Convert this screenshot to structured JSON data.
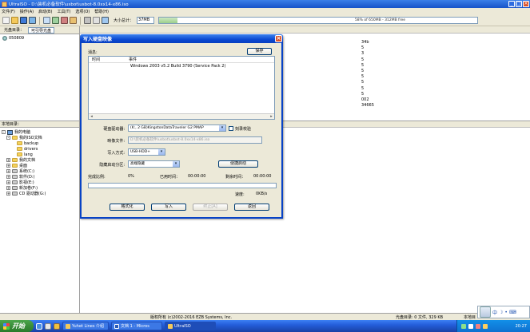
{
  "window": {
    "title": "UltraISO - D:\\装机必备软件\\usbot\\usbot-8.0xx14-x86.iso"
  },
  "menu": [
    "文件(F)",
    "操作(A)",
    "启动(B)",
    "工具(T)",
    "选项(O)",
    "帮助(H)"
  ],
  "toolbar": {
    "capacity_label": "大小总计：",
    "capacity_value": "37MB",
    "capacity_info": "58% of 650MB - 312MB free",
    "capacity_fraction": 0.058
  },
  "left_top": {
    "tabs": [
      "光盘目录：",
      "可引导光盘"
    ],
    "root_label": "050809"
  },
  "right_top": {
    "numbers": [
      "34b",
      "5",
      "3",
      "5",
      "5",
      "5",
      "5",
      "5",
      "5",
      "5",
      "002",
      "34665"
    ]
  },
  "local": {
    "header": "本地目录：",
    "items": [
      {
        "label": "我的电脑",
        "level": 0,
        "icon": "computer-icon",
        "exp": "-"
      },
      {
        "label": "我的ISO文档",
        "level": 1,
        "icon": "folder-icon",
        "exp": "-"
      },
      {
        "label": "backup",
        "level": 2,
        "icon": "folder-icon",
        "exp": ""
      },
      {
        "label": "drivers",
        "level": 2,
        "icon": "folder-icon",
        "exp": ""
      },
      {
        "label": "lang",
        "level": 2,
        "icon": "folder-icon",
        "exp": ""
      },
      {
        "label": "我的文档",
        "level": 1,
        "icon": "folder-icon",
        "exp": "+"
      },
      {
        "label": "桌面",
        "level": 1,
        "icon": "folder-icon",
        "exp": "+"
      },
      {
        "label": "系统(C:)",
        "level": 1,
        "icon": "drive-icon",
        "exp": "+"
      },
      {
        "label": "软件(D:)",
        "level": 1,
        "icon": "drive-icon",
        "exp": "+"
      },
      {
        "label": "影视(E:)",
        "level": 1,
        "icon": "drive-icon",
        "exp": "+"
      },
      {
        "label": "新加卷(F:)",
        "level": 1,
        "icon": "drive-icon",
        "exp": "+"
      },
      {
        "label": "CD 驱动器(G:)",
        "level": 1,
        "icon": "cd-drive-icon",
        "exp": "+"
      }
    ]
  },
  "status": {
    "copyright": "版权所有 (c)2002-2016 EZB Systems, Inc.",
    "cd_dir": "光盘目录: 0 文件, 329 KB",
    "local_dir": "本地目"
  },
  "taskbar": {
    "start": "开始",
    "tasks": [
      "Yuhet Lines 介绍",
      "文档 1 - Micros",
      "UltraISO"
    ],
    "clock": "20:27"
  },
  "dialog": {
    "title": "写入硬盘映像",
    "log_label": "消息:",
    "save": "保存",
    "log_cols": [
      "时间",
      "事件"
    ],
    "log_rows": [
      {
        "time": "",
        "event": "Windows 2003 v5.2 Build 3790 (Service Pack 2)"
      }
    ],
    "drive_label": "硬盘驱动器:",
    "drive_value": "(K:, 2 GB)KingstonDataTraveler G2 PMAP",
    "verify_label": "刻录校验",
    "image_label": "映像文件:",
    "image_value": "D:\\装机必备软件\\usbot\\usbot-8.0xx14-x86.iso",
    "mode_label": "写入方式:",
    "mode_value": "USB-HDD+",
    "hide_label": "隐藏启动分区:",
    "hide_value": "高端隐藏",
    "boot_btn": "便捷启动",
    "done_label": "完成比例:",
    "done_value": "0%",
    "elapsed_label": "已用时间：",
    "elapsed_value": "00:00:00",
    "remain_label": "剩余时间：",
    "remain_value": "00:00:00",
    "speed_label": "速度:",
    "speed_value": "0KB/s",
    "progress": 0,
    "buttons": [
      "格式化",
      "写入",
      "终止[A]",
      "返回"
    ]
  }
}
